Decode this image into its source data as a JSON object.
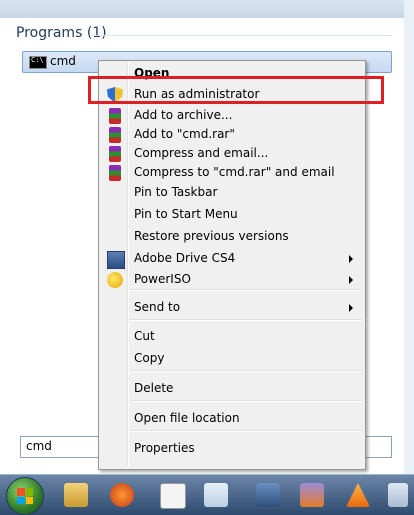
{
  "start_menu": {
    "section_header": "Programs (1)",
    "result_label": "cmd",
    "search_value": "cmd"
  },
  "context_menu": {
    "items": [
      {
        "label": "Open",
        "icon": null,
        "submenu": false
      },
      {
        "label": "Run as administrator",
        "icon": "uac-shield-icon",
        "submenu": false
      },
      {
        "label": "Add to archive...",
        "icon": "winrar-icon",
        "submenu": false
      },
      {
        "label": "Add to \"cmd.rar\"",
        "icon": "winrar-icon",
        "submenu": false
      },
      {
        "label": "Compress and email...",
        "icon": "winrar-icon",
        "submenu": false
      },
      {
        "label": "Compress to \"cmd.rar\" and email",
        "icon": "winrar-icon",
        "submenu": false
      },
      {
        "label": "Pin to Taskbar",
        "icon": null,
        "submenu": false
      },
      {
        "label": "Pin to Start Menu",
        "icon": null,
        "submenu": false
      },
      {
        "label": "Restore previous versions",
        "icon": null,
        "submenu": false
      },
      {
        "label": "Adobe Drive CS4",
        "icon": "adobe-drive-icon",
        "submenu": true
      },
      {
        "label": "PowerISO",
        "icon": "poweriso-icon",
        "submenu": true
      },
      {
        "label": "Send to",
        "icon": null,
        "submenu": true
      },
      {
        "label": "Cut",
        "icon": null,
        "submenu": false
      },
      {
        "label": "Copy",
        "icon": null,
        "submenu": false
      },
      {
        "label": "Delete",
        "icon": null,
        "submenu": false
      },
      {
        "label": "Open file location",
        "icon": null,
        "submenu": false
      },
      {
        "label": "Properties",
        "icon": null,
        "submenu": false
      }
    ]
  },
  "annotation": {
    "highlight_color": "#e01e25",
    "highlighted_item": "Run as administrator"
  },
  "taskbar": {
    "icons": [
      "start-orb-icon",
      "explorer-icon",
      "firefox-icon",
      "paint-icon",
      "notepad-icon",
      "network-icon",
      "virtualbox-icon",
      "vlc-icon",
      "misc-icon"
    ]
  }
}
